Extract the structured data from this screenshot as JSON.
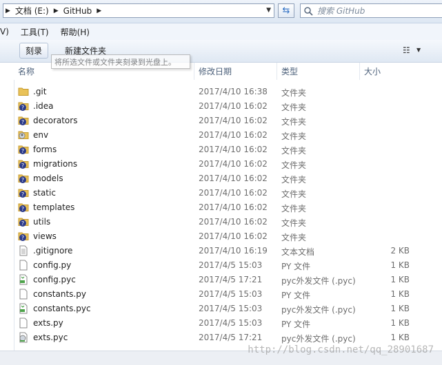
{
  "address": {
    "crumbs": [
      "文档 (E:)",
      "GitHub"
    ],
    "search_placeholder": "搜索 GitHub"
  },
  "menu": [
    "V)",
    "工具(T)",
    "帮助(H)"
  ],
  "toolbar": {
    "burn_label": "刻录",
    "new_folder_label": "新建文件夹",
    "tooltip": "将所选文件或文件夹刻录到光盘上。"
  },
  "columns": {
    "name": "名称",
    "date": "修改日期",
    "type": "类型",
    "size": "大小"
  },
  "files": [
    {
      "name": ".git",
      "date": "2017/4/10 16:38",
      "type": "文件夹",
      "size": "",
      "icon": "folder-icon"
    },
    {
      "name": ".idea",
      "date": "2017/4/10 16:02",
      "type": "文件夹",
      "size": "",
      "icon": "folder-conflict-icon"
    },
    {
      "name": "decorators",
      "date": "2017/4/10 16:02",
      "type": "文件夹",
      "size": "",
      "icon": "folder-conflict-icon"
    },
    {
      "name": "env",
      "date": "2017/4/10 16:02",
      "type": "文件夹",
      "size": "",
      "icon": "folder-user-icon"
    },
    {
      "name": "forms",
      "date": "2017/4/10 16:02",
      "type": "文件夹",
      "size": "",
      "icon": "folder-conflict-icon"
    },
    {
      "name": "migrations",
      "date": "2017/4/10 16:02",
      "type": "文件夹",
      "size": "",
      "icon": "folder-conflict-icon"
    },
    {
      "name": "models",
      "date": "2017/4/10 16:02",
      "type": "文件夹",
      "size": "",
      "icon": "folder-conflict-icon"
    },
    {
      "name": "static",
      "date": "2017/4/10 16:02",
      "type": "文件夹",
      "size": "",
      "icon": "folder-conflict-icon"
    },
    {
      "name": "templates",
      "date": "2017/4/10 16:02",
      "type": "文件夹",
      "size": "",
      "icon": "folder-conflict-icon"
    },
    {
      "name": "utils",
      "date": "2017/4/10 16:02",
      "type": "文件夹",
      "size": "",
      "icon": "folder-conflict-icon"
    },
    {
      "name": "views",
      "date": "2017/4/10 16:02",
      "type": "文件夹",
      "size": "",
      "icon": "folder-conflict-icon"
    },
    {
      "name": ".gitignore",
      "date": "2017/4/10 16:19",
      "type": "文本文档",
      "size": "2 KB",
      "icon": "text-file-icon"
    },
    {
      "name": "config.py",
      "date": "2017/4/5 15:03",
      "type": "PY 文件",
      "size": "1 KB",
      "icon": "file-icon"
    },
    {
      "name": "config.pyc",
      "date": "2017/4/5 17:21",
      "type": "pyc外发文件 (.pyc)",
      "size": "1 KB",
      "icon": "pyc-file-icon"
    },
    {
      "name": "constants.py",
      "date": "2017/4/5 15:03",
      "type": "PY 文件",
      "size": "1 KB",
      "icon": "file-icon"
    },
    {
      "name": "constants.pyc",
      "date": "2017/4/5 15:03",
      "type": "pyc外发文件 (.pyc)",
      "size": "1 KB",
      "icon": "pyc-file-icon"
    },
    {
      "name": "exts.py",
      "date": "2017/4/5 15:03",
      "type": "PY 文件",
      "size": "1 KB",
      "icon": "file-icon"
    },
    {
      "name": "exts.pyc",
      "date": "2017/4/5 17:21",
      "type": "pyc外发文件 (.pyc)",
      "size": "1 KB",
      "icon": "pyc-user-file-icon"
    }
  ],
  "watermark": "http://blog.csdn.net/qq_28901687"
}
